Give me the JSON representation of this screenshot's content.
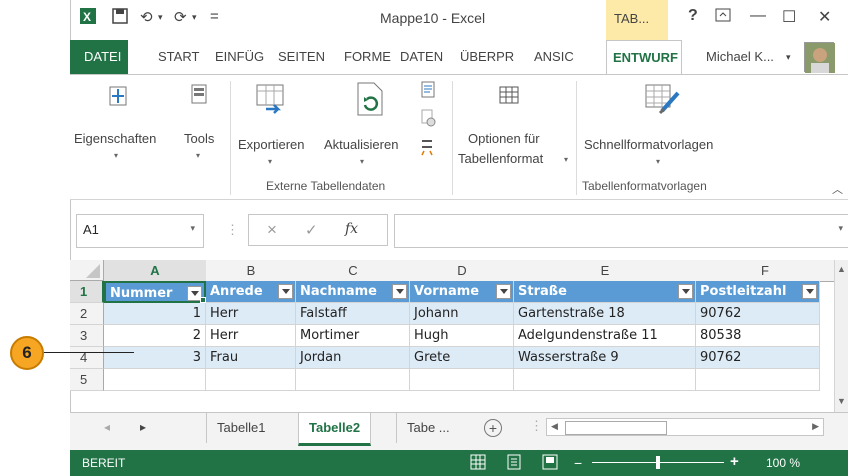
{
  "window": {
    "title": "Mappe10 - Excel",
    "context_tab": "TAB...",
    "help": "?",
    "user": "Michael K...",
    "user_caret": "▾"
  },
  "ribbon_tabs": [
    "DATEI",
    "START",
    "EINFÜG",
    "SEITEN",
    "FORME",
    "DATEN",
    "ÜBERPR",
    "ANSIC",
    "ENTWURF"
  ],
  "ribbon": {
    "eigenschaften": "Eigenschaften",
    "tools": "Tools",
    "exportieren": "Exportieren",
    "aktualisieren": "Aktualisieren",
    "optionen1": "Optionen für",
    "optionen2": "Tabellenformat",
    "schnell": "Schnellformatvorlagen",
    "group_extern": "Externe Tabellendaten",
    "group_format": "Tabellenformatvorlagen",
    "caret": "▾"
  },
  "formula_bar": {
    "name_box": "A1",
    "cancel": "×",
    "enter": "✓",
    "fx": "fx",
    "value": ""
  },
  "grid": {
    "columns": [
      "A",
      "B",
      "C",
      "D",
      "E",
      "F"
    ],
    "rows": [
      "1",
      "2",
      "3",
      "4",
      "5"
    ],
    "header": [
      "Nummer",
      "Anrede",
      "Nachname",
      "Vorname",
      "Straße",
      "Postleitzahl"
    ],
    "data": [
      [
        "1",
        "Herr",
        "Falstaff",
        "Johann",
        "Gartenstraße 18",
        "90762"
      ],
      [
        "2",
        "Herr",
        "Mortimer",
        "Hugh",
        "Adelgundenstraße 11",
        "80538"
      ],
      [
        "3",
        "Frau",
        "Jordan",
        "Grete",
        "Wasserstraße 9",
        "90762"
      ]
    ]
  },
  "sheets": {
    "tab1": "Tabelle1",
    "tab2": "Tabelle2",
    "tab3": "Tabe ...",
    "add": "+"
  },
  "status": {
    "ready": "BEREIT",
    "zoom": "100 %"
  },
  "callout": "6",
  "colors": {
    "accent": "#217346",
    "table_header": "#5b9bd5",
    "band": "#ddebf7",
    "callout": "#f6a623"
  }
}
